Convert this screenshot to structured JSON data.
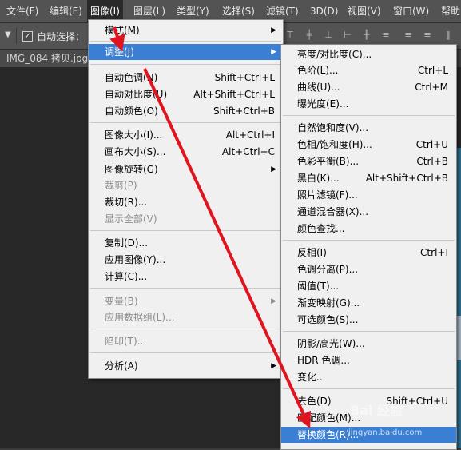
{
  "menubar": {
    "items": [
      {
        "label": "文件(F)"
      },
      {
        "label": "编辑(E)"
      },
      {
        "label": "图像(I)"
      },
      {
        "label": "图层(L)"
      },
      {
        "label": "类型(Y)"
      },
      {
        "label": "选择(S)"
      },
      {
        "label": "滤镜(T)"
      },
      {
        "label": "3D(D)"
      },
      {
        "label": "视图(V)"
      },
      {
        "label": "窗口(W)"
      },
      {
        "label": "帮助"
      }
    ]
  },
  "options": {
    "auto_select_label": "自动选择：",
    "auto_select_checked": true
  },
  "document": {
    "tab_label": "IMG_084 拷贝.jpg"
  },
  "image_menu": {
    "items": [
      {
        "label": "模式(M)",
        "shortcut": "",
        "submenu": true
      },
      {
        "label": "调整(J)",
        "shortcut": "",
        "submenu": true,
        "highlighted": true
      },
      {
        "label": "自动色调(N)",
        "shortcut": "Shift+Ctrl+L"
      },
      {
        "label": "自动对比度(U)",
        "shortcut": "Alt+Shift+Ctrl+L"
      },
      {
        "label": "自动颜色(O)",
        "shortcut": "Shift+Ctrl+B"
      },
      {
        "label": "图像大小(I)...",
        "shortcut": "Alt+Ctrl+I"
      },
      {
        "label": "画布大小(S)...",
        "shortcut": "Alt+Ctrl+C"
      },
      {
        "label": "图像旋转(G)",
        "shortcut": "",
        "submenu": true
      },
      {
        "label": "裁剪(P)",
        "shortcut": "",
        "disabled": true
      },
      {
        "label": "裁切(R)...",
        "shortcut": ""
      },
      {
        "label": "显示全部(V)",
        "shortcut": "",
        "disabled": true
      },
      {
        "label": "复制(D)...",
        "shortcut": ""
      },
      {
        "label": "应用图像(Y)...",
        "shortcut": ""
      },
      {
        "label": "计算(C)...",
        "shortcut": ""
      },
      {
        "label": "变量(B)",
        "shortcut": "",
        "submenu": true,
        "disabled": true
      },
      {
        "label": "应用数据组(L)...",
        "shortcut": "",
        "disabled": true
      },
      {
        "label": "陷印(T)...",
        "shortcut": "",
        "disabled": true
      },
      {
        "label": "分析(A)",
        "shortcut": "",
        "submenu": true
      }
    ]
  },
  "adjust_menu": {
    "items": [
      {
        "label": "亮度/对比度(C)...",
        "shortcut": ""
      },
      {
        "label": "色阶(L)...",
        "shortcut": "Ctrl+L"
      },
      {
        "label": "曲线(U)...",
        "shortcut": "Ctrl+M"
      },
      {
        "label": "曝光度(E)...",
        "shortcut": ""
      },
      {
        "label": "自然饱和度(V)...",
        "shortcut": ""
      },
      {
        "label": "色相/饱和度(H)...",
        "shortcut": "Ctrl+U"
      },
      {
        "label": "色彩平衡(B)...",
        "shortcut": "Ctrl+B"
      },
      {
        "label": "黑白(K)...",
        "shortcut": "Alt+Shift+Ctrl+B"
      },
      {
        "label": "照片滤镜(F)...",
        "shortcut": ""
      },
      {
        "label": "通道混合器(X)...",
        "shortcut": ""
      },
      {
        "label": "颜色查找...",
        "shortcut": ""
      },
      {
        "label": "反相(I)",
        "shortcut": "Ctrl+I"
      },
      {
        "label": "色调分离(P)...",
        "shortcut": ""
      },
      {
        "label": "阈值(T)...",
        "shortcut": ""
      },
      {
        "label": "渐变映射(G)...",
        "shortcut": ""
      },
      {
        "label": "可选颜色(S)...",
        "shortcut": ""
      },
      {
        "label": "阴影/高光(W)...",
        "shortcut": ""
      },
      {
        "label": "HDR 色调...",
        "shortcut": ""
      },
      {
        "label": "变化...",
        "shortcut": ""
      },
      {
        "label": "去色(D)",
        "shortcut": "Shift+Ctrl+U"
      },
      {
        "label": "匹配颜色(M)...",
        "shortcut": ""
      },
      {
        "label": "替换颜色(R)...",
        "shortcut": "",
        "highlighted": true
      }
    ]
  },
  "watermark": {
    "logo_text": "Bai 经验",
    "url": "jingyan.baidu.com"
  },
  "colors": {
    "menu_highlight": "#3a7fd4",
    "annotation_arrow": "#e0141e"
  }
}
